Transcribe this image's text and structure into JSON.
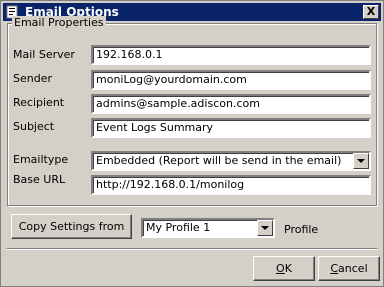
{
  "window": {
    "title": "Email Options",
    "close_label": "X"
  },
  "group": {
    "legend": "Email Properties"
  },
  "fields": {
    "mail_server": {
      "label": "Mail Server",
      "value": "192.168.0.1"
    },
    "sender": {
      "label": "Sender",
      "value": "moniLog@yourdomain.com"
    },
    "recipient": {
      "label": "Recipient",
      "value": "admins@sample.adiscon.com"
    },
    "subject": {
      "label": "Subject",
      "value": "Event Logs Summary"
    },
    "emailtype": {
      "label": "Emailtype",
      "value": "Embedded (Report will be send in the email)"
    },
    "base_url": {
      "label": "Base URL",
      "value": "http://192.168.0.1/monilog"
    }
  },
  "profile": {
    "copy_button": "Copy Settings from",
    "selected": "My Profile 1",
    "label": "Profile"
  },
  "footer": {
    "ok_first": "O",
    "ok_rest": "K",
    "cancel_first": "C",
    "cancel_rest": "ancel"
  },
  "icons": {
    "title": "app-icon",
    "dropdown": "chevron-down-icon"
  },
  "colors": {
    "titlebar": "#0a246a",
    "face": "#d4d0c8"
  }
}
